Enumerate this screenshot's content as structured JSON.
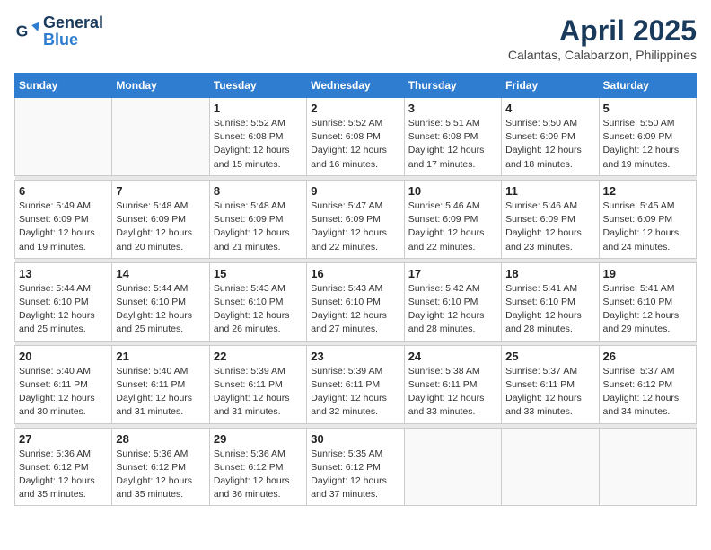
{
  "header": {
    "logo_general": "General",
    "logo_blue": "Blue",
    "month": "April 2025",
    "location": "Calantas, Calabarzon, Philippines"
  },
  "days_of_week": [
    "Sunday",
    "Monday",
    "Tuesday",
    "Wednesday",
    "Thursday",
    "Friday",
    "Saturday"
  ],
  "weeks": [
    [
      {
        "day": "",
        "info": ""
      },
      {
        "day": "",
        "info": ""
      },
      {
        "day": "1",
        "info": "Sunrise: 5:52 AM\nSunset: 6:08 PM\nDaylight: 12 hours and 15 minutes."
      },
      {
        "day": "2",
        "info": "Sunrise: 5:52 AM\nSunset: 6:08 PM\nDaylight: 12 hours and 16 minutes."
      },
      {
        "day": "3",
        "info": "Sunrise: 5:51 AM\nSunset: 6:08 PM\nDaylight: 12 hours and 17 minutes."
      },
      {
        "day": "4",
        "info": "Sunrise: 5:50 AM\nSunset: 6:09 PM\nDaylight: 12 hours and 18 minutes."
      },
      {
        "day": "5",
        "info": "Sunrise: 5:50 AM\nSunset: 6:09 PM\nDaylight: 12 hours and 19 minutes."
      }
    ],
    [
      {
        "day": "6",
        "info": "Sunrise: 5:49 AM\nSunset: 6:09 PM\nDaylight: 12 hours and 19 minutes."
      },
      {
        "day": "7",
        "info": "Sunrise: 5:48 AM\nSunset: 6:09 PM\nDaylight: 12 hours and 20 minutes."
      },
      {
        "day": "8",
        "info": "Sunrise: 5:48 AM\nSunset: 6:09 PM\nDaylight: 12 hours and 21 minutes."
      },
      {
        "day": "9",
        "info": "Sunrise: 5:47 AM\nSunset: 6:09 PM\nDaylight: 12 hours and 22 minutes."
      },
      {
        "day": "10",
        "info": "Sunrise: 5:46 AM\nSunset: 6:09 PM\nDaylight: 12 hours and 22 minutes."
      },
      {
        "day": "11",
        "info": "Sunrise: 5:46 AM\nSunset: 6:09 PM\nDaylight: 12 hours and 23 minutes."
      },
      {
        "day": "12",
        "info": "Sunrise: 5:45 AM\nSunset: 6:09 PM\nDaylight: 12 hours and 24 minutes."
      }
    ],
    [
      {
        "day": "13",
        "info": "Sunrise: 5:44 AM\nSunset: 6:10 PM\nDaylight: 12 hours and 25 minutes."
      },
      {
        "day": "14",
        "info": "Sunrise: 5:44 AM\nSunset: 6:10 PM\nDaylight: 12 hours and 25 minutes."
      },
      {
        "day": "15",
        "info": "Sunrise: 5:43 AM\nSunset: 6:10 PM\nDaylight: 12 hours and 26 minutes."
      },
      {
        "day": "16",
        "info": "Sunrise: 5:43 AM\nSunset: 6:10 PM\nDaylight: 12 hours and 27 minutes."
      },
      {
        "day": "17",
        "info": "Sunrise: 5:42 AM\nSunset: 6:10 PM\nDaylight: 12 hours and 28 minutes."
      },
      {
        "day": "18",
        "info": "Sunrise: 5:41 AM\nSunset: 6:10 PM\nDaylight: 12 hours and 28 minutes."
      },
      {
        "day": "19",
        "info": "Sunrise: 5:41 AM\nSunset: 6:10 PM\nDaylight: 12 hours and 29 minutes."
      }
    ],
    [
      {
        "day": "20",
        "info": "Sunrise: 5:40 AM\nSunset: 6:11 PM\nDaylight: 12 hours and 30 minutes."
      },
      {
        "day": "21",
        "info": "Sunrise: 5:40 AM\nSunset: 6:11 PM\nDaylight: 12 hours and 31 minutes."
      },
      {
        "day": "22",
        "info": "Sunrise: 5:39 AM\nSunset: 6:11 PM\nDaylight: 12 hours and 31 minutes."
      },
      {
        "day": "23",
        "info": "Sunrise: 5:39 AM\nSunset: 6:11 PM\nDaylight: 12 hours and 32 minutes."
      },
      {
        "day": "24",
        "info": "Sunrise: 5:38 AM\nSunset: 6:11 PM\nDaylight: 12 hours and 33 minutes."
      },
      {
        "day": "25",
        "info": "Sunrise: 5:37 AM\nSunset: 6:11 PM\nDaylight: 12 hours and 33 minutes."
      },
      {
        "day": "26",
        "info": "Sunrise: 5:37 AM\nSunset: 6:12 PM\nDaylight: 12 hours and 34 minutes."
      }
    ],
    [
      {
        "day": "27",
        "info": "Sunrise: 5:36 AM\nSunset: 6:12 PM\nDaylight: 12 hours and 35 minutes."
      },
      {
        "day": "28",
        "info": "Sunrise: 5:36 AM\nSunset: 6:12 PM\nDaylight: 12 hours and 35 minutes."
      },
      {
        "day": "29",
        "info": "Sunrise: 5:36 AM\nSunset: 6:12 PM\nDaylight: 12 hours and 36 minutes."
      },
      {
        "day": "30",
        "info": "Sunrise: 5:35 AM\nSunset: 6:12 PM\nDaylight: 12 hours and 37 minutes."
      },
      {
        "day": "",
        "info": ""
      },
      {
        "day": "",
        "info": ""
      },
      {
        "day": "",
        "info": ""
      }
    ]
  ]
}
